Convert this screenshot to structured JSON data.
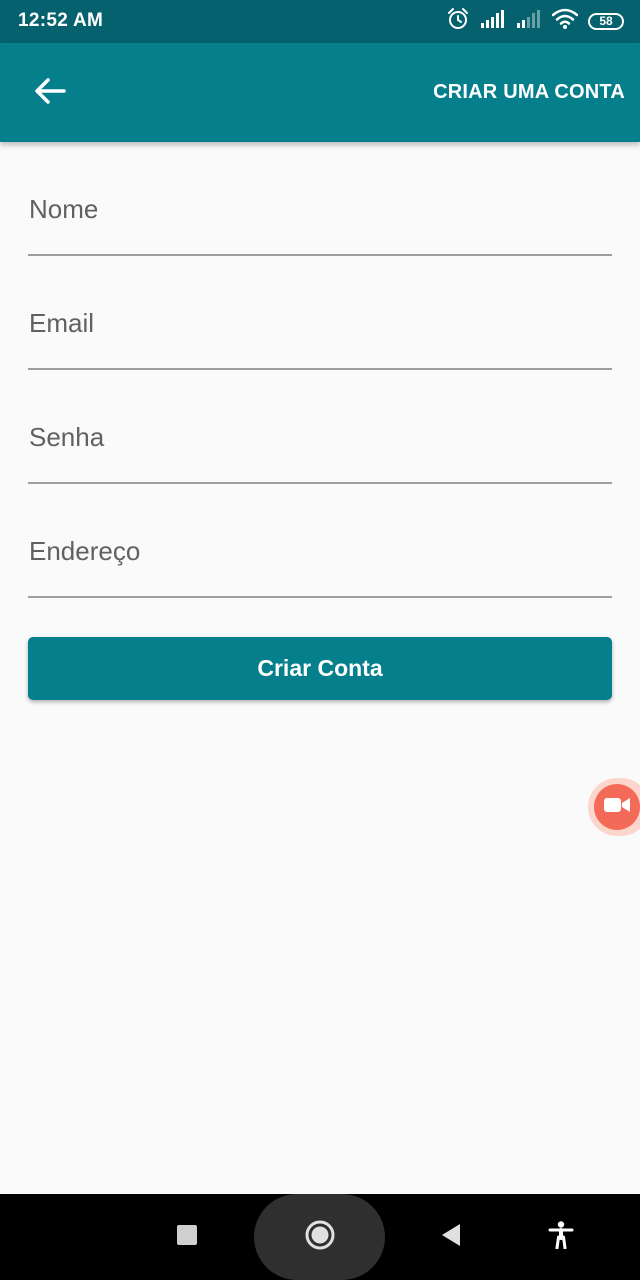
{
  "status_bar": {
    "time": "12:52 AM",
    "battery": "58",
    "icons": [
      "alarm-icon",
      "signal-full-icon",
      "signal-weak-icon",
      "wifi-icon",
      "battery-icon"
    ]
  },
  "app_bar": {
    "title": "CRIAR UMA CONTA",
    "back_icon": "arrow-left-icon"
  },
  "form": {
    "fields": [
      {
        "name": "nome",
        "placeholder": "Nome",
        "value": ""
      },
      {
        "name": "email",
        "placeholder": "Email",
        "value": ""
      },
      {
        "name": "senha",
        "placeholder": "Senha",
        "value": ""
      },
      {
        "name": "endereco",
        "placeholder": "Endereço",
        "value": ""
      }
    ],
    "submit_label": "Criar Conta"
  },
  "floating_button": {
    "icon": "video-camera-icon"
  },
  "nav_bar": {
    "icons": [
      "recents-square-icon",
      "home-circle-icon",
      "back-triangle-icon",
      "accessibility-icon"
    ]
  },
  "colors": {
    "primary": "#067f8c",
    "status_bar": "#04616d",
    "background": "#fafafa",
    "record": "#f36b58"
  }
}
